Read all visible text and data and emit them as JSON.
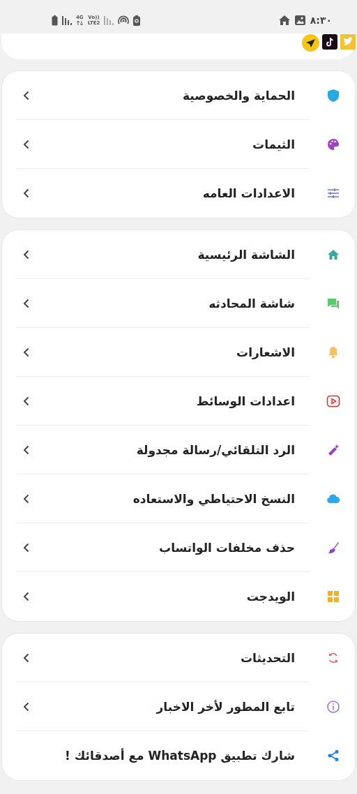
{
  "status_bar": {
    "time": "٨:٣٠",
    "network": [
      "4G",
      "Vo))",
      "LTE2"
    ]
  },
  "sections": [
    {
      "items": [
        {
          "label": "الحماية والخصوصية",
          "chevron": true
        },
        {
          "label": "الثيمات",
          "chevron": true
        },
        {
          "label": "الاعدادات العامه",
          "chevron": true
        }
      ]
    },
    {
      "items": [
        {
          "label": "الشاشة الرئيسية",
          "chevron": true
        },
        {
          "label": "شاشة المحادثه",
          "chevron": true
        },
        {
          "label": "الاشعارات",
          "chevron": true
        },
        {
          "label": "اعدادات الوسائط",
          "chevron": true
        },
        {
          "label": "الرد التلقائي/رسالة مجدولة",
          "chevron": true
        },
        {
          "label": "النسخ الاحتياطي والاستعاده",
          "chevron": true
        },
        {
          "label": "حذف مخلفات الواتساب",
          "chevron": true
        },
        {
          "label": "الويدجت",
          "chevron": true
        }
      ]
    },
    {
      "items": [
        {
          "label": "التحديثات",
          "chevron": true
        },
        {
          "label": "تابع المطور لأخر الاخبار",
          "chevron": true
        },
        {
          "label": "شارك تطبيق WhatsApp مع أصدقائك !",
          "chevron": false
        }
      ]
    }
  ]
}
